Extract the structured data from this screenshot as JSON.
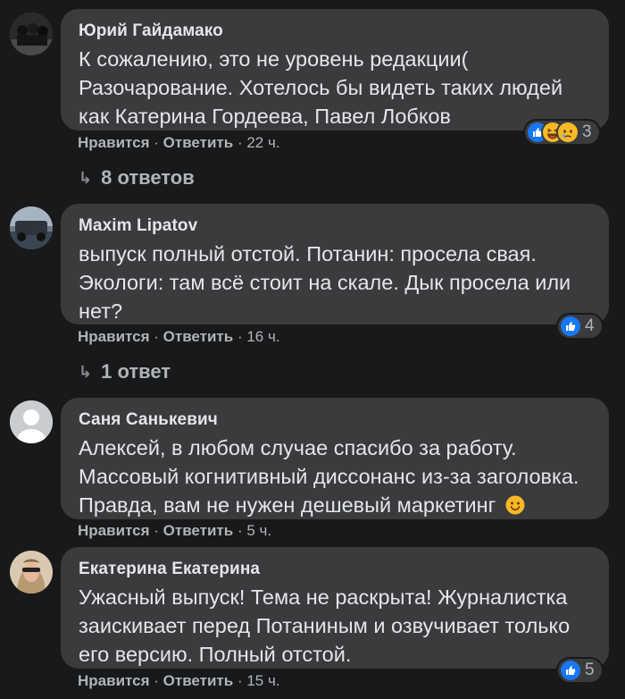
{
  "comments": [
    {
      "author": "Юрий Гайдамако",
      "text": "К сожалению, это не уровень редакции( Разочарование. Хотелось бы видеть таких людей как Катерина Гордеева, Павел Лобков",
      "like_label": "Нравится",
      "reply_label": "Ответить",
      "time": "22 ч.",
      "reaction_count": "3",
      "reaction_icons": [
        "like-icon",
        "haha-icon",
        "sad-icon"
      ],
      "replies_label": "8 ответов"
    },
    {
      "author": "Maxim Lipatov",
      "text": "выпуск полный отстой. Потанин: просела свая. Экологи: там всё стоит на скале. Дык просела или нет?",
      "like_label": "Нравится",
      "reply_label": "Ответить",
      "time": "16 ч.",
      "reaction_count": "4",
      "reaction_icons": [
        "like-icon"
      ],
      "replies_label": "1 ответ"
    },
    {
      "author": "Саня Санькевич",
      "text": "Алексей, в любом случае спасибо за работу. Массовый когнитивный диссонанс из-за заголовка. Правда, вам не нужен дешевый маркетинг",
      "like_label": "Нравится",
      "reply_label": "Ответить",
      "time": "5 ч."
    },
    {
      "author": "Екатерина Екатерина",
      "text": "Ужасный выпуск! Тема не раскрыта! Журналистка заискивает перед Потаниным и озвучивает только его версию. Полный отстой.",
      "like_label": "Нравится",
      "reply_label": "Ответить",
      "time": "15 ч.",
      "reaction_count": "5",
      "reaction_icons": [
        "like-icon"
      ]
    }
  ],
  "separator": "·",
  "colors": {
    "background": "#18191a",
    "bubble": "#3a3b3c",
    "primary_text": "#e4e6eb",
    "secondary_text": "#b0b3b8",
    "like_blue": "#1877f2",
    "emoji_yellow": "#f7b928"
  }
}
